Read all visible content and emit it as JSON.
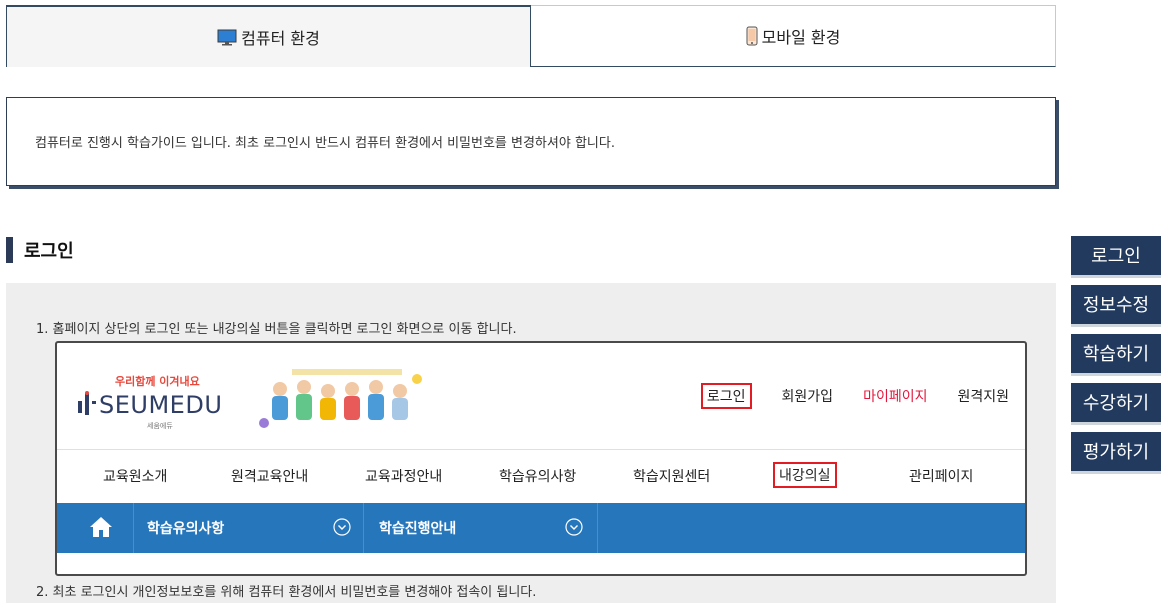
{
  "tabs": [
    {
      "label": "컴퓨터 환경",
      "icon": "monitor-icon",
      "active": true
    },
    {
      "label": "모바일 환경",
      "icon": "mobile-phone-icon",
      "active": false
    }
  ],
  "info": {
    "text": "컴퓨터로 진행시 학습가이드 입니다. 최초 로그인시 반드시 컴퓨터 환경에서 비밀번호를 변경하셔야 합니다."
  },
  "section": {
    "title": "로그인"
  },
  "steps": [
    "1.  홈페이지 상단의 로그인 또는 내강의실 버튼을 클릭하면 로그인 화면으로 이동 합니다.",
    "2.  최초 로그인시 개인정보보호를 위해 컴퓨터 환경에서 비밀번호를 변경해야 접속이 됩니다."
  ],
  "screenshot": {
    "logo": {
      "tagline": "우리함께 이겨내요",
      "name": "SEUMEDU",
      "sub": "세움에듀"
    },
    "top_links": [
      "로그인",
      "회원가입",
      "마이페이지",
      "원격지원"
    ],
    "main_nav": [
      "교육원소개",
      "원격교육안내",
      "교육과정안내",
      "학습유의사항",
      "학습지원센터",
      "내강의실",
      "관리페이지"
    ],
    "sub_nav": [
      "학습유의사항",
      "학습진행안내"
    ]
  },
  "side_buttons": [
    "로그인",
    "정보수정",
    "학습하기",
    "수강하기",
    "평가하기"
  ],
  "colors": {
    "navy": "#223a5e",
    "blue_bar": "#2676bc",
    "highlight_red": "#e31b23",
    "mypage_red": "#e3173d"
  }
}
